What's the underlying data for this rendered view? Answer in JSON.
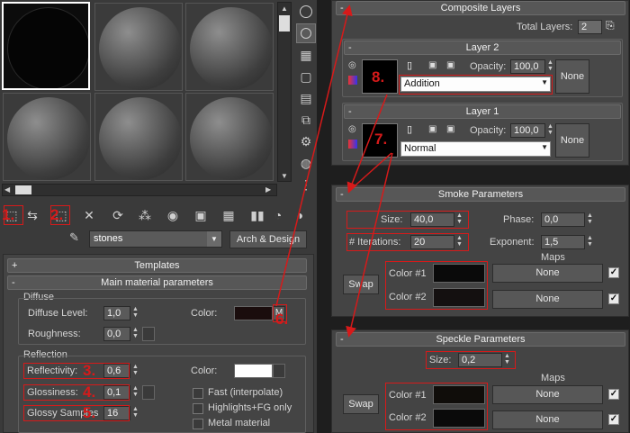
{
  "colors": {
    "accent_red": "#d61a1a",
    "panel_bg": "#444444",
    "app_bg": "#1e1e1e"
  },
  "material_editor": {
    "material_name": "stones",
    "material_type": "Arch & Design",
    "rollouts": {
      "templates": "Templates",
      "main": "Main material parameters"
    },
    "templates_toggle": "+",
    "main_toggle": "-",
    "diffuse": {
      "group": "Diffuse",
      "level_label": "Diffuse Level:",
      "level_value": "1,0",
      "roughness_label": "Roughness:",
      "roughness_value": "0,0",
      "color_label": "Color:",
      "map_button": "M"
    },
    "reflection": {
      "group": "Reflection",
      "reflectivity_label": "Reflectivity:",
      "reflectivity_value": "0,6",
      "glossiness_label": "Glossiness:",
      "glossiness_value": "0,1",
      "glossy_samples_label": "Glossy Samples",
      "glossy_samples_value": "16",
      "color_label": "Color:",
      "fast_label": "Fast (interpolate)",
      "highlights_label": "Highlights+FG only",
      "metal_label": "Metal material"
    }
  },
  "composite": {
    "title": "Composite Layers",
    "toggle": "-",
    "total_label": "Total Layers:",
    "total_value": "2",
    "layers": [
      {
        "title": "Layer 2",
        "opacity_label": "Opacity:",
        "opacity_value": "100,0",
        "blend": "Addition",
        "map_button": "None"
      },
      {
        "title": "Layer 1",
        "opacity_label": "Opacity:",
        "opacity_value": "100,0",
        "blend": "Normal",
        "map_button": "None"
      }
    ]
  },
  "smoke": {
    "title": "Smoke Parameters",
    "toggle": "-",
    "size_label": "Size:",
    "size_value": "40,0",
    "phase_label": "Phase:",
    "phase_value": "0,0",
    "iterations_label": "# Iterations:",
    "iterations_value": "20",
    "exponent_label": "Exponent:",
    "exponent_value": "1,5",
    "maps_label": "Maps",
    "swap_label": "Swap",
    "color1_label": "Color #1",
    "color2_label": "Color #2",
    "map1": "None",
    "map2": "None"
  },
  "speckle": {
    "title": "Speckle Parameters",
    "toggle": "-",
    "size_label": "Size:",
    "size_value": "0,2",
    "maps_label": "Maps",
    "swap_label": "Swap",
    "color1_label": "Color #1",
    "color2_label": "Color #2",
    "map1": "None",
    "map2": "None"
  },
  "annotations": {
    "n1": "1.",
    "n2": "2.",
    "n3": "3.",
    "n4": "4.",
    "n5": "5.",
    "n6": "6.",
    "n7": "7.",
    "n8": "8."
  }
}
